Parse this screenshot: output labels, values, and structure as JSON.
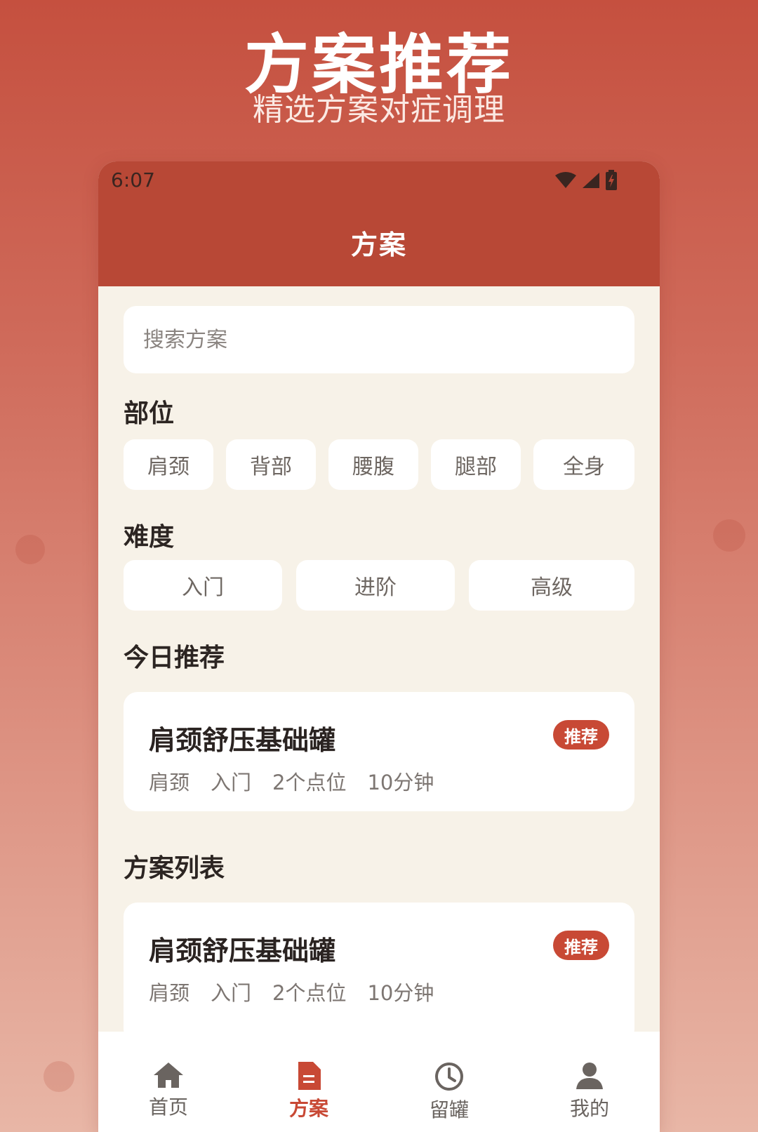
{
  "promo": {
    "title": "方案推荐",
    "subtitle": "精选方案对症调理"
  },
  "status_bar": {
    "time": "6:07",
    "icons": [
      "wifi-icon",
      "signal-icon",
      "battery-icon"
    ]
  },
  "app_bar": {
    "title": "方案"
  },
  "search": {
    "placeholder": "搜索方案",
    "value": ""
  },
  "body_part": {
    "title": "部位",
    "options": [
      "肩颈",
      "背部",
      "腰腹",
      "腿部",
      "全身"
    ]
  },
  "difficulty": {
    "title": "难度",
    "options": [
      "入门",
      "进阶",
      "高级"
    ]
  },
  "today": {
    "title": "今日推荐",
    "card": {
      "name": "肩颈舒压基础罐",
      "badge": "推荐",
      "part": "肩颈",
      "level": "入门",
      "points": "2个点位",
      "duration": "10分钟"
    }
  },
  "plan_list": {
    "title": "方案列表",
    "items": [
      {
        "name": "肩颈舒压基础罐",
        "badge": "推荐",
        "part": "肩颈",
        "level": "入门",
        "points": "2个点位",
        "duration": "10分钟"
      }
    ]
  },
  "tabbar": {
    "items": [
      {
        "label": "首页",
        "icon": "home-icon",
        "active": false
      },
      {
        "label": "方案",
        "icon": "document-icon",
        "active": true
      },
      {
        "label": "留罐",
        "icon": "clock-icon",
        "active": false
      },
      {
        "label": "我的",
        "icon": "user-icon",
        "active": false
      }
    ]
  },
  "colors": {
    "brand": "#b84836",
    "accent": "#c84935",
    "page_bg": "#f7f2e8",
    "inactive_tab": "#6a6460"
  }
}
